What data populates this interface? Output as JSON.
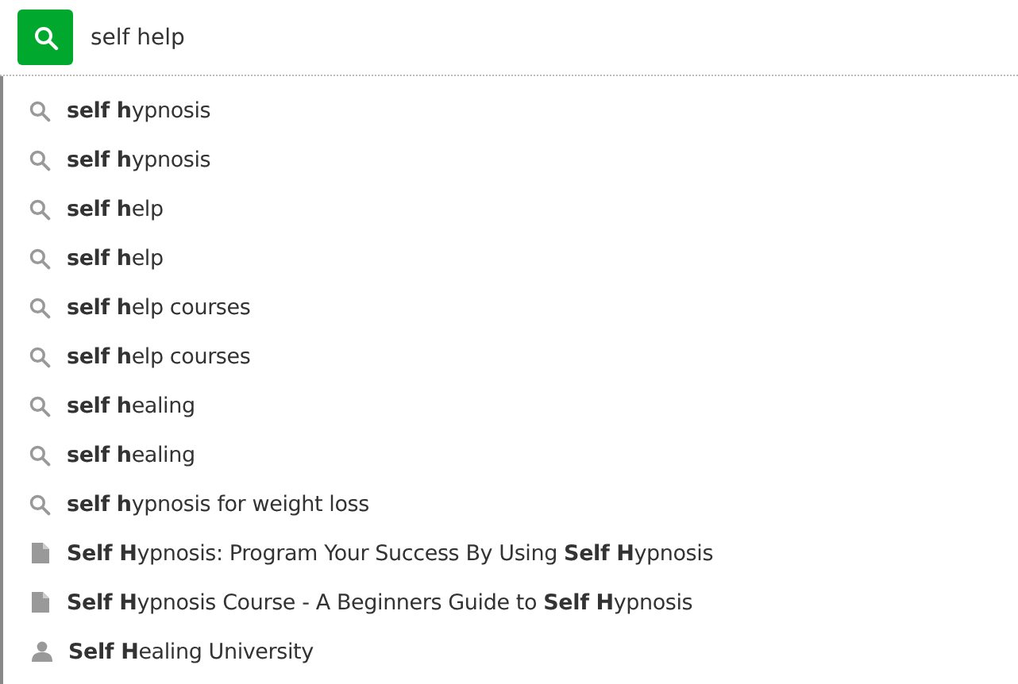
{
  "search": {
    "value": "self help"
  },
  "suggestions": [
    {
      "kind": "query",
      "text": "**self h**ypnosis"
    },
    {
      "kind": "query",
      "text": "**self h**ypnosis"
    },
    {
      "kind": "query",
      "text": "**self h**elp"
    },
    {
      "kind": "query",
      "text": "**self h**elp"
    },
    {
      "kind": "query",
      "text": "**self h**elp courses"
    },
    {
      "kind": "query",
      "text": "**self h**elp courses"
    },
    {
      "kind": "query",
      "text": "**self h**ealing"
    },
    {
      "kind": "query",
      "text": "**self h**ealing"
    },
    {
      "kind": "query",
      "text": "**self h**ypnosis for weight loss"
    },
    {
      "kind": "course",
      "text": "**Self H**ypnosis: Program Your Success By Using **Self H**ypnosis"
    },
    {
      "kind": "course",
      "text": "**Self H**ypnosis Course - A Beginners Guide to **Self H**ypnosis"
    },
    {
      "kind": "user",
      "text": "**Self H**ealing University"
    }
  ]
}
